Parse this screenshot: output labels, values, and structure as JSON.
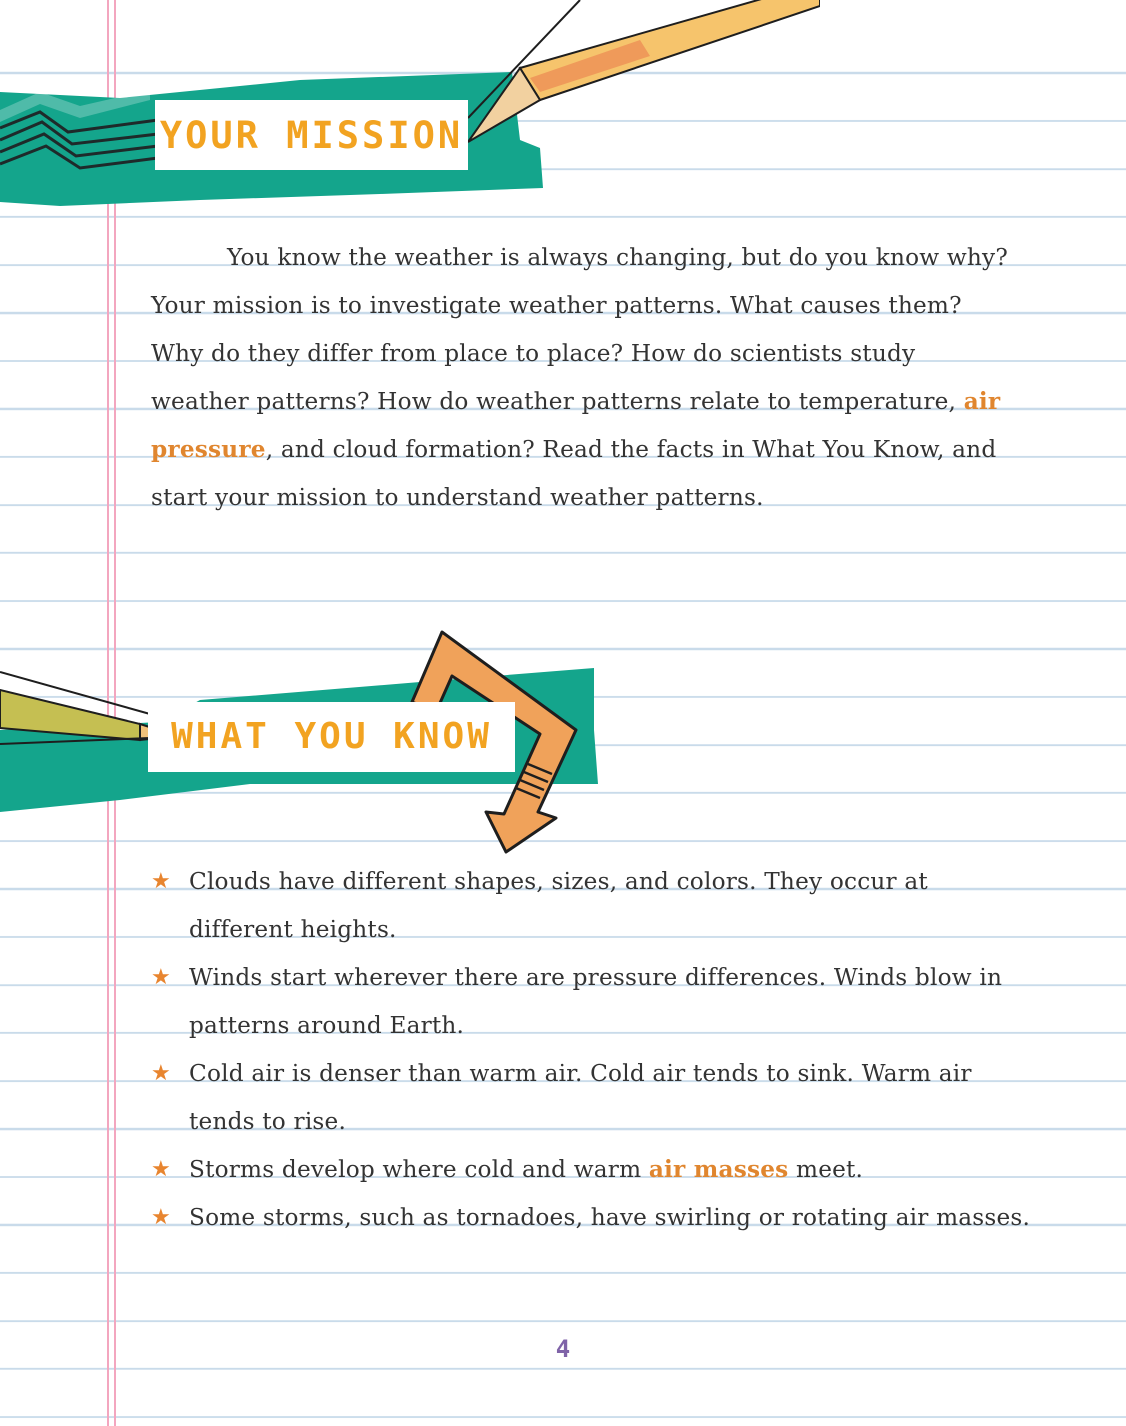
{
  "mission": {
    "heading": "YOUR MISSION",
    "paragraph_before": "You know the weather is always changing, but do you know why? Your mission is to investigate weather patterns. What causes them? Why do they differ from place to place? How do scientists study weather patterns? How do weather patterns relate to temperature, ",
    "highlight": "air pressure",
    "paragraph_after": ", and cloud formation? Read the facts in What You Know, and start your mission to understand weather patterns."
  },
  "know": {
    "heading": "WHAT YOU KNOW",
    "facts": [
      {
        "text": "Clouds have different shapes, sizes, and colors. They occur at different heights."
      },
      {
        "text": "Winds start wherever there are pressure differences. Winds blow in patterns around Earth."
      },
      {
        "text": "Cold air is denser than warm air. Cold air tends to sink. Warm air tends to rise."
      },
      {
        "before": "Storms develop where cold and warm ",
        "highlight": "air masses",
        "after": " meet."
      },
      {
        "text": "Some storms, such as tornadoes, have swirling or rotating air masses."
      }
    ]
  },
  "page_number": "4",
  "colors": {
    "teal_tape": "#14a58c",
    "heading_orange": "#f2a321",
    "highlight_orange": "#e0862f",
    "star_orange": "#e8852f",
    "page_number_purple": "#7f63a8",
    "ruled_line_blue": "#c9dbea",
    "margin_line_pink": "#f3a6bf"
  },
  "icons": [
    "star-bullet-icon",
    "pencil-icon",
    "bent-arrow-icon",
    "zigzag-icon"
  ]
}
